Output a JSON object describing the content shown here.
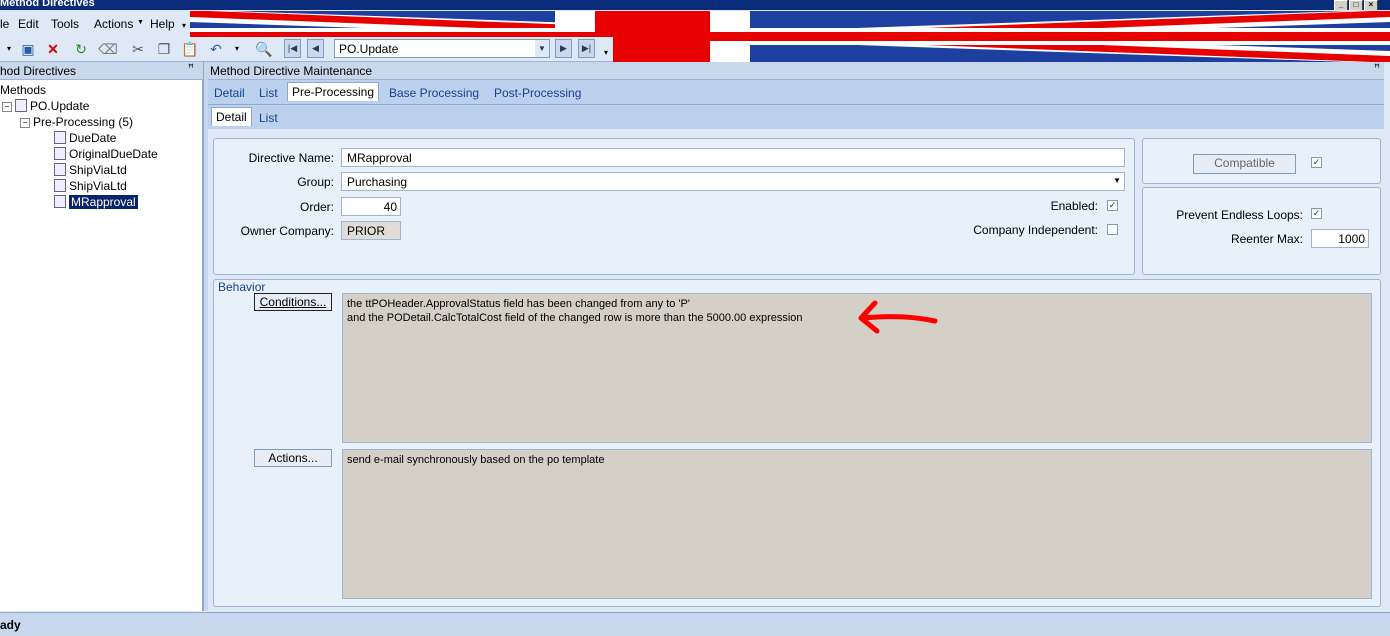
{
  "window": {
    "title": "Method Directives"
  },
  "menu": {
    "items": [
      "le",
      "Edit",
      "Tools",
      "Actions",
      "Help"
    ]
  },
  "toolbar": {
    "po_value": "PO.Update"
  },
  "left_panel": {
    "header": "hod Directives",
    "tree": {
      "root": "Methods",
      "method": "PO.Update",
      "group": "Pre-Processing (5)",
      "items": [
        "DueDate",
        "OriginalDueDate",
        "ShipViaLtd",
        "ShipViaLtd",
        "MRapproval"
      ]
    }
  },
  "right_panel": {
    "header": "Method Directive Maintenance",
    "tabs": [
      "Detail",
      "List",
      "Pre-Processing",
      "Base Processing",
      "Post-Processing"
    ],
    "subtabs": [
      "Detail",
      "List"
    ]
  },
  "form": {
    "directive_name_label": "Directive Name:",
    "directive_name": "MRapproval",
    "group_label": "Group:",
    "group": "Purchasing",
    "order_label": "Order:",
    "order": "40",
    "owner_label": "Owner Company:",
    "owner": "PRIOR",
    "enabled_label": "Enabled:",
    "company_independent_label": "Company Independent:",
    "compatible_button": "Compatible",
    "prevent_loops_label": "Prevent Endless Loops:",
    "reenter_label": "Reenter Max:",
    "reenter_max": "1000"
  },
  "behavior": {
    "title": "Behavior",
    "conditions_button": "Conditions...",
    "conditions_line1": "the ttPOHeader.ApprovalStatus field has been changed from any to 'P'",
    "conditions_line2": "and the PODetail.CalcTotalCost field of the changed row is more than the 5000.00 expression",
    "actions_button": "Actions...",
    "actions_text": "send e-mail synchronously based on the po template"
  },
  "status": {
    "text": "ady"
  },
  "colors": {
    "annotation_arrow": "#ff0000",
    "selected": "#0a246a"
  }
}
